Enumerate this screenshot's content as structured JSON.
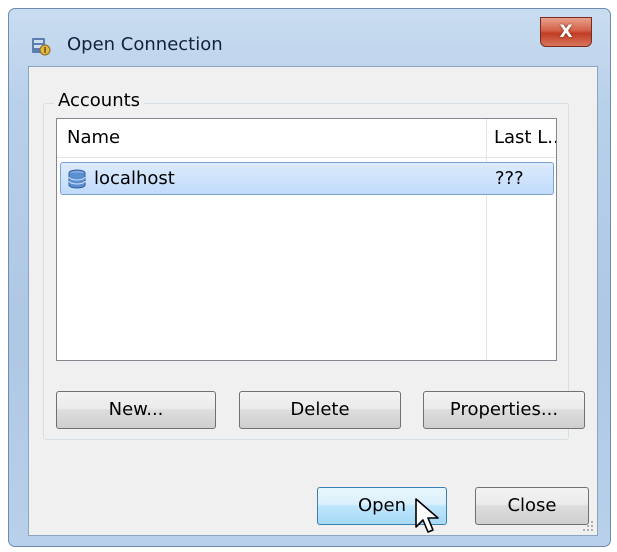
{
  "window": {
    "title": "Open Connection",
    "close_label": "X"
  },
  "accounts": {
    "group_label": "Accounts",
    "columns": [
      "Name",
      "Last L..."
    ],
    "rows": [
      {
        "name": "localhost",
        "last": "???",
        "selected": true
      }
    ]
  },
  "buttons": {
    "new": "New...",
    "delete": "Delete",
    "properties": "Properties...",
    "open": "Open",
    "close": "Close"
  },
  "icons": {
    "app": "connection-icon",
    "row": "database-icon",
    "cursor": "mouse-pointer-icon"
  }
}
